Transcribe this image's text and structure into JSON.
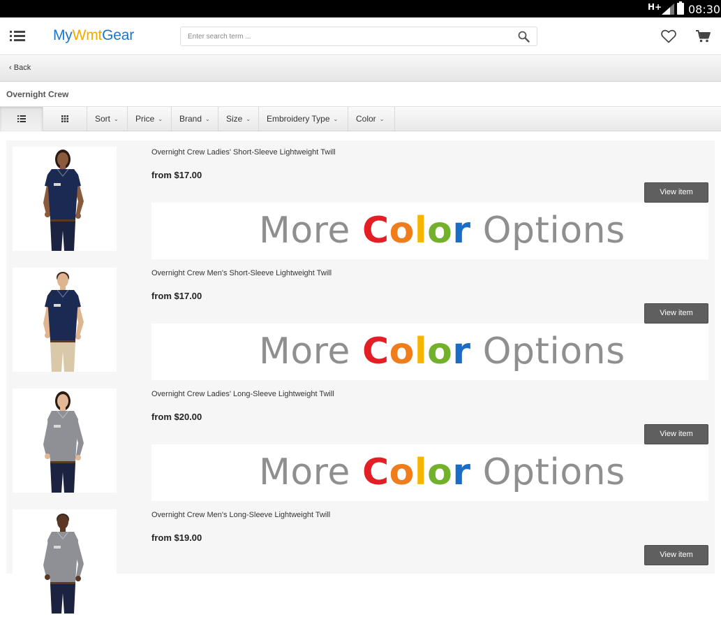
{
  "status_bar": {
    "network": "H+",
    "time": "08:30"
  },
  "header": {
    "logo_part1": "My",
    "logo_part2": "Wmt",
    "logo_part3": "Gear",
    "search_placeholder": "Enter search term ..."
  },
  "nav": {
    "back_label": "Back"
  },
  "page": {
    "title": "Overnight Crew"
  },
  "filters": [
    {
      "label": "Sort"
    },
    {
      "label": "Price"
    },
    {
      "label": "Brand"
    },
    {
      "label": "Size"
    },
    {
      "label": "Embroidery Type"
    },
    {
      "label": "Color"
    }
  ],
  "banner": {
    "word1": "More",
    "word2": "Color",
    "word3": "Options"
  },
  "products": [
    {
      "name": "Overnight Crew Ladies' Short-Sleeve Lightweight Twill",
      "price": "from $17.00",
      "button": "View item",
      "shirt_color": "#1b2a52",
      "pants_color": "#1c2340",
      "skin": "#8a5a3c"
    },
    {
      "name": "Overnight Crew Men's Short-Sleeve Lightweight Twill",
      "price": "from $17.00",
      "button": "View item",
      "shirt_color": "#1b2a52",
      "pants_color": "#d9c9a8",
      "skin": "#e0b48f"
    },
    {
      "name": "Overnight Crew Ladies' Long-Sleeve Lightweight Twill",
      "price": "from $20.00",
      "button": "View item",
      "shirt_color": "#8e9095",
      "pants_color": "#1c2340",
      "skin": "#e3b897"
    },
    {
      "name": "Overnight Crew Men's Long-Sleeve Lightweight Twill",
      "price": "from $19.00",
      "button": "View item",
      "shirt_color": "#8e9095",
      "pants_color": "#1c2340",
      "skin": "#5a3824"
    }
  ],
  "colors": {
    "logo_blue": "#1a75cf",
    "logo_yellow": "#f5a800",
    "button_gray": "#5f5f5f"
  }
}
